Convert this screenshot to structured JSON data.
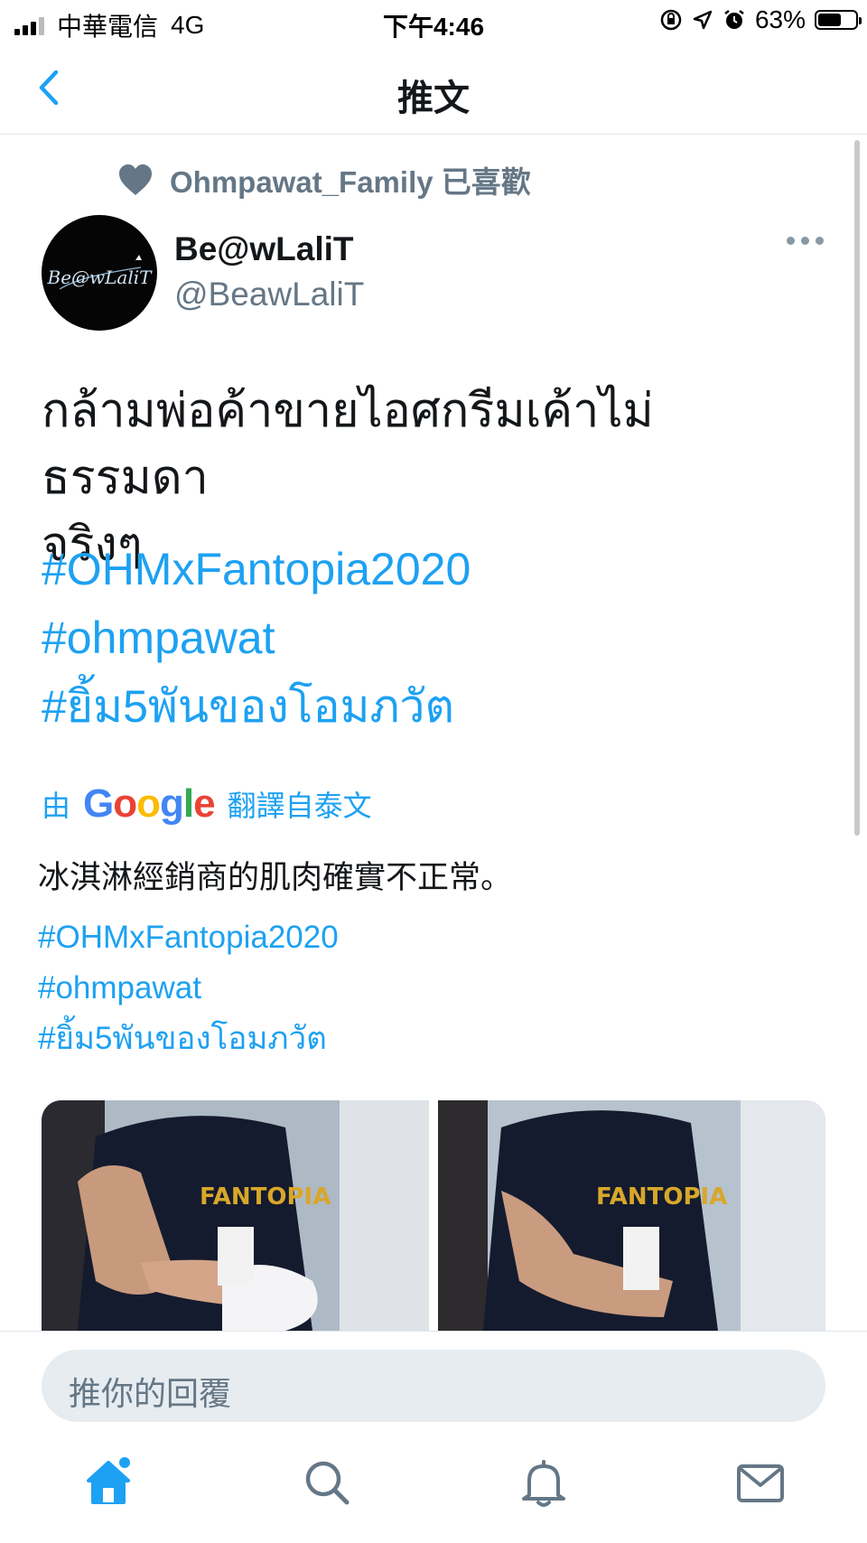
{
  "status_bar": {
    "carrier": "中華電信",
    "network": "4G",
    "time": "下午4:46",
    "battery": "63%",
    "battery_level": 0.63
  },
  "nav": {
    "title": "推文",
    "back_icon": "chevron-left-icon"
  },
  "tweet": {
    "liked_by": "Ohmpawat_Family 已喜歡",
    "avatar_text": "Be@wLaliT",
    "display_name": "Be@wLaliT",
    "handle": "@BeawLaliT",
    "text_line1": "กล้ามพ่อค้าขายไอศกรีมเค้าไม่ธรรมดา",
    "text_line2": "จริงๆ",
    "hashtags": [
      "#OHMxFantopia2020",
      "#ohmpawat",
      "#ยิ้ม5พันของโอมภวัต"
    ],
    "translated_prefix": "由",
    "translated_brand": "Google",
    "translated_suffix": "翻譯自泰文",
    "translation": "冰淇淋經銷商的肌肉確實不正常。",
    "photo_shirt_text": "FANTOPIA"
  },
  "reply": {
    "placeholder": "推你的回覆"
  },
  "tabbar": {
    "items": [
      "home-icon",
      "search-icon",
      "bell-icon",
      "mail-icon"
    ]
  },
  "colors": {
    "accent": "#1da1f2",
    "muted": "#657786",
    "text": "#14171a"
  }
}
